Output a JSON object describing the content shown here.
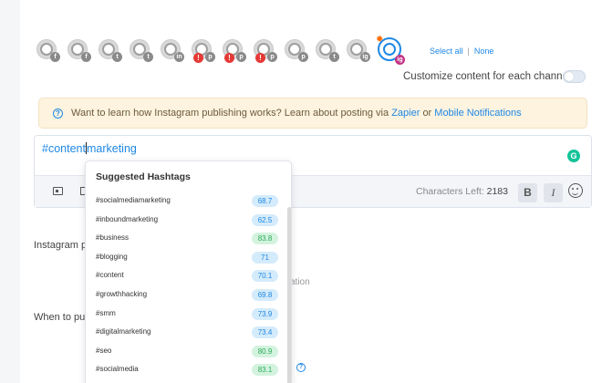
{
  "channels": [
    {
      "network": "f",
      "warning": false,
      "active": false
    },
    {
      "network": "f",
      "warning": false,
      "active": false
    },
    {
      "network": "t",
      "warning": false,
      "active": false
    },
    {
      "network": "t",
      "warning": false,
      "active": false
    },
    {
      "network": "in",
      "warning": false,
      "active": false
    },
    {
      "network": "p",
      "warning": true,
      "active": false
    },
    {
      "network": "p",
      "warning": true,
      "active": false
    },
    {
      "network": "p",
      "warning": true,
      "active": false
    },
    {
      "network": "p",
      "warning": false,
      "active": false
    },
    {
      "network": "t",
      "warning": false,
      "active": false
    },
    {
      "network": "ig",
      "warning": false,
      "active": false
    },
    {
      "network": "ig",
      "warning": false,
      "active": true
    }
  ],
  "select_all": "Select all",
  "select_none": "None",
  "customize_label": "Customize content for each channel",
  "info": {
    "text": "Want to learn how Instagram publishing works? Learn about posting via",
    "zapier": "Zapier",
    "or": "or",
    "mobile": "Mobile Notifications"
  },
  "editor": {
    "text_before_caret": "#content",
    "text_after_caret": "marketing",
    "grammarly": "G",
    "chars_label": "Characters Left:",
    "chars_value": "2183",
    "bold": "B",
    "italic": "I"
  },
  "background": {
    "instagram_label": "Instagram p",
    "faint_text": "ation",
    "when_label": "When to pub"
  },
  "hashtags": {
    "title": "Suggested Hashtags",
    "items": [
      {
        "tag": "#socialmediamarketing",
        "score": "68.7",
        "color": "blue"
      },
      {
        "tag": "#inboundmarketing",
        "score": "62.5",
        "color": "blue"
      },
      {
        "tag": "#business",
        "score": "83.8",
        "color": "green"
      },
      {
        "tag": "#blogging",
        "score": "71",
        "color": "blue"
      },
      {
        "tag": "#content",
        "score": "70.1",
        "color": "blue"
      },
      {
        "tag": "#growthhacking",
        "score": "69.8",
        "color": "blue"
      },
      {
        "tag": "#smm",
        "score": "73.9",
        "color": "blue"
      },
      {
        "tag": "#digitalmarketing",
        "score": "73.4",
        "color": "blue"
      },
      {
        "tag": "#seo",
        "score": "80.9",
        "color": "green"
      },
      {
        "tag": "#socialmedia",
        "score": "83.1",
        "color": "green"
      }
    ]
  }
}
